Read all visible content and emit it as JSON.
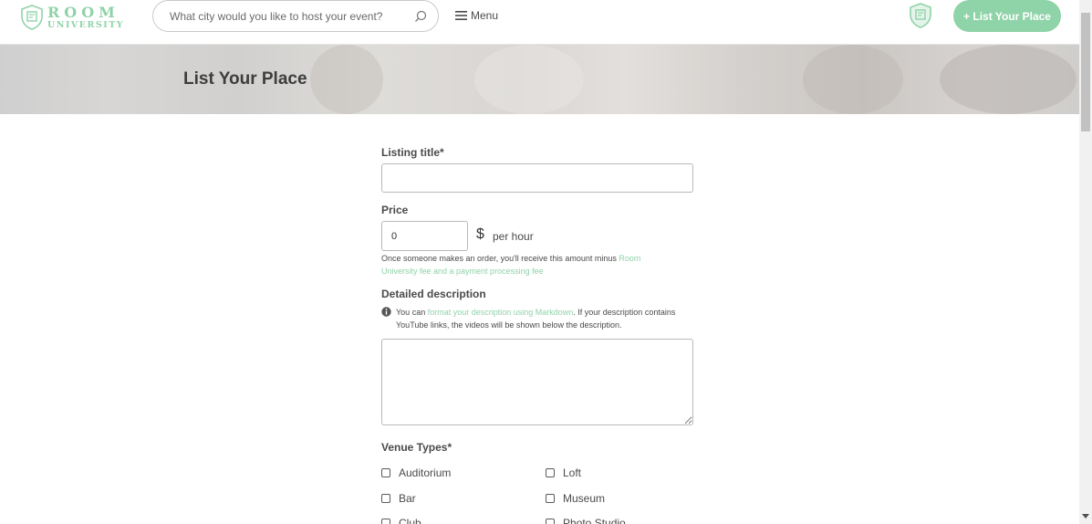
{
  "header": {
    "logo_word1": "ROOM",
    "logo_word2": "UNIVERSITY",
    "search_placeholder": "What city would you like to host your event?",
    "menu_label": "Menu",
    "cta_label": "+ List Your Place"
  },
  "hero": {
    "title": "List Your Place"
  },
  "form": {
    "listing_title_label": "Listing title*",
    "listing_title_value": "",
    "price_label": "Price",
    "price_value": "0",
    "currency_symbol": "$",
    "price_unit": "per hour",
    "price_help_text": "Once someone makes an order, you'll receive this amount minus ",
    "price_help_link": "Room University fee and a payment processing fee",
    "description_label": "Detailed description",
    "description_help_prefix": "You can ",
    "description_help_link": "format your description using Markdown",
    "description_help_suffix": ". If your description contains YouTube links, the videos will be shown below the description.",
    "description_value": "",
    "venue_types_label": "Venue Types*",
    "venue_types_left": [
      "Auditorium",
      "Bar",
      "Club"
    ],
    "venue_types_right": [
      "Loft",
      "Museum",
      "Photo Studio"
    ]
  },
  "colors": {
    "brand_green": "#8fd3a8",
    "text": "#4a4a4a"
  }
}
